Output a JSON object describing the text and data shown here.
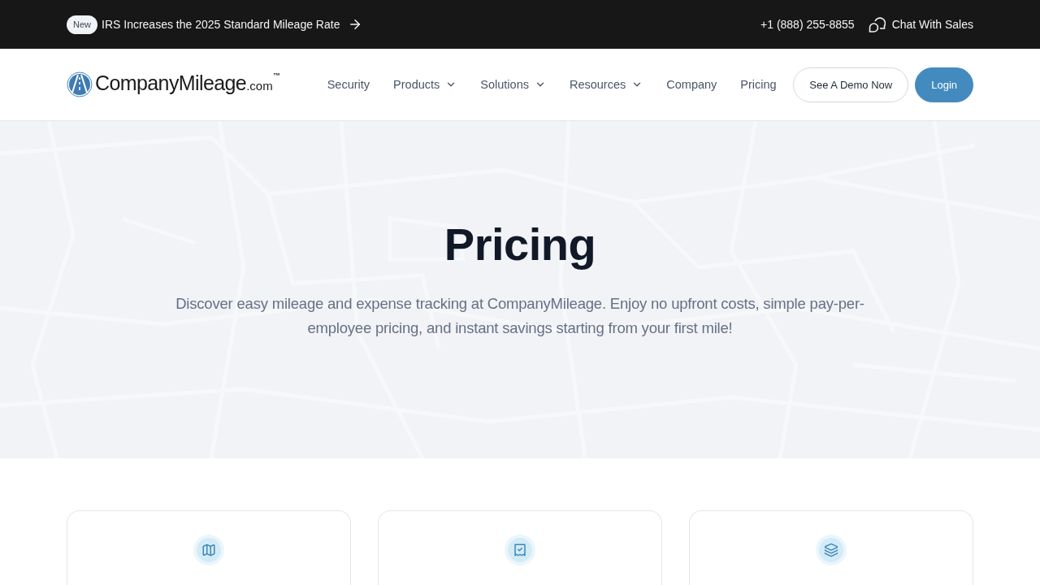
{
  "announcement": {
    "badge": "New",
    "text": "IRS Increases the 2025 Standard Mileage Rate"
  },
  "contact": {
    "phone": "+1 (888) 255-8855",
    "chat": "Chat With Sales"
  },
  "logo": {
    "name": "CompanyMileage",
    "suffix": ".com",
    "mark": "™"
  },
  "nav": [
    {
      "label": "Security",
      "dropdown": false
    },
    {
      "label": "Products",
      "dropdown": true
    },
    {
      "label": "Solutions",
      "dropdown": true
    },
    {
      "label": "Resources",
      "dropdown": true
    },
    {
      "label": "Company",
      "dropdown": false
    },
    {
      "label": "Pricing",
      "dropdown": false
    }
  ],
  "actions": [
    {
      "label": "See A Demo Now",
      "kind": "outline"
    },
    {
      "label": "Login",
      "kind": "primary"
    }
  ],
  "hero": {
    "title": "Pricing",
    "subtitle": "Discover easy mileage and expense tracking at CompanyMileage. Enjoy no upfront costs, simple pay-per-employee pricing, and instant savings starting from your first mile!"
  },
  "cards": [
    {
      "kind": "map"
    },
    {
      "kind": "receipt"
    },
    {
      "kind": "layers"
    }
  ]
}
